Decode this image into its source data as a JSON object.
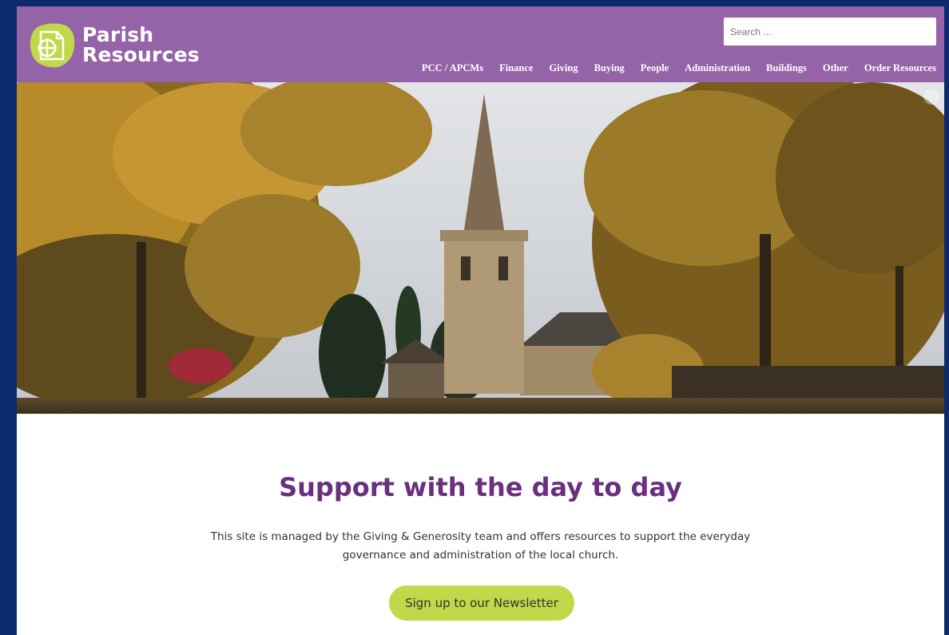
{
  "site": {
    "logo_line1": "Parish",
    "logo_line2": "Resources",
    "brand_color": "#9563a8",
    "accent_color": "#c1d84a",
    "icon": "cross-document-icon"
  },
  "search": {
    "placeholder": "Search ..."
  },
  "nav": {
    "items": [
      {
        "label": "PCC / APCMs"
      },
      {
        "label": "Finance"
      },
      {
        "label": "Giving"
      },
      {
        "label": "Buying"
      },
      {
        "label": "People"
      },
      {
        "label": "Administration"
      },
      {
        "label": "Buildings"
      },
      {
        "label": "Other"
      },
      {
        "label": "Order Resources"
      }
    ]
  },
  "hero": {
    "icon": "expand-icon"
  },
  "main": {
    "headline": "Support with the day to day",
    "intro": "This site is managed by the Giving & Generosity team and offers resources to support the everyday governance and administration of the local church.",
    "cta_label": "Sign up to our Newsletter"
  }
}
